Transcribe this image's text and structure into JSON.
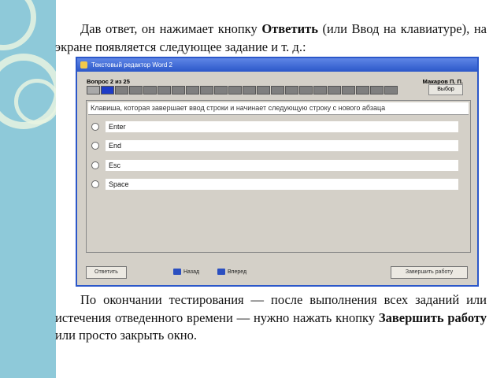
{
  "text": {
    "p1_a": "Дав ответ, он нажимает кнопку ",
    "p1_bold": "Ответить",
    "p1_b": " (или Ввод на клавиатуре), на экране появляется следующее задание и т. д.:",
    "p2_a": "По окончании тестирования — после выполнения всех заданий или истечения отведенного времени — нужно нажать кнопку ",
    "p2_bold": "Завершить работу",
    "p2_b": " или просто закрыть окно."
  },
  "window": {
    "title": "Текстовый редактор Word 2",
    "question_counter": "Вопрос 2 из 25",
    "user": "Макаров П. П.",
    "select_button": "Выбор",
    "progress": {
      "total": 25,
      "current": 2
    },
    "question": "Клавиша, которая завершает ввод строки и начинает следующую строку с нового абзаца",
    "options": [
      "Enter",
      "End",
      "Esc",
      "Space"
    ],
    "answer_button": "Ответить",
    "back_button": "Назад",
    "forward_button": "Вперед",
    "finish_button": "Завершить работу"
  },
  "colors": {
    "sidebar": "#8ec9d9",
    "titlebar": "#2b57c9",
    "window_bg": "#d4d0c8"
  }
}
